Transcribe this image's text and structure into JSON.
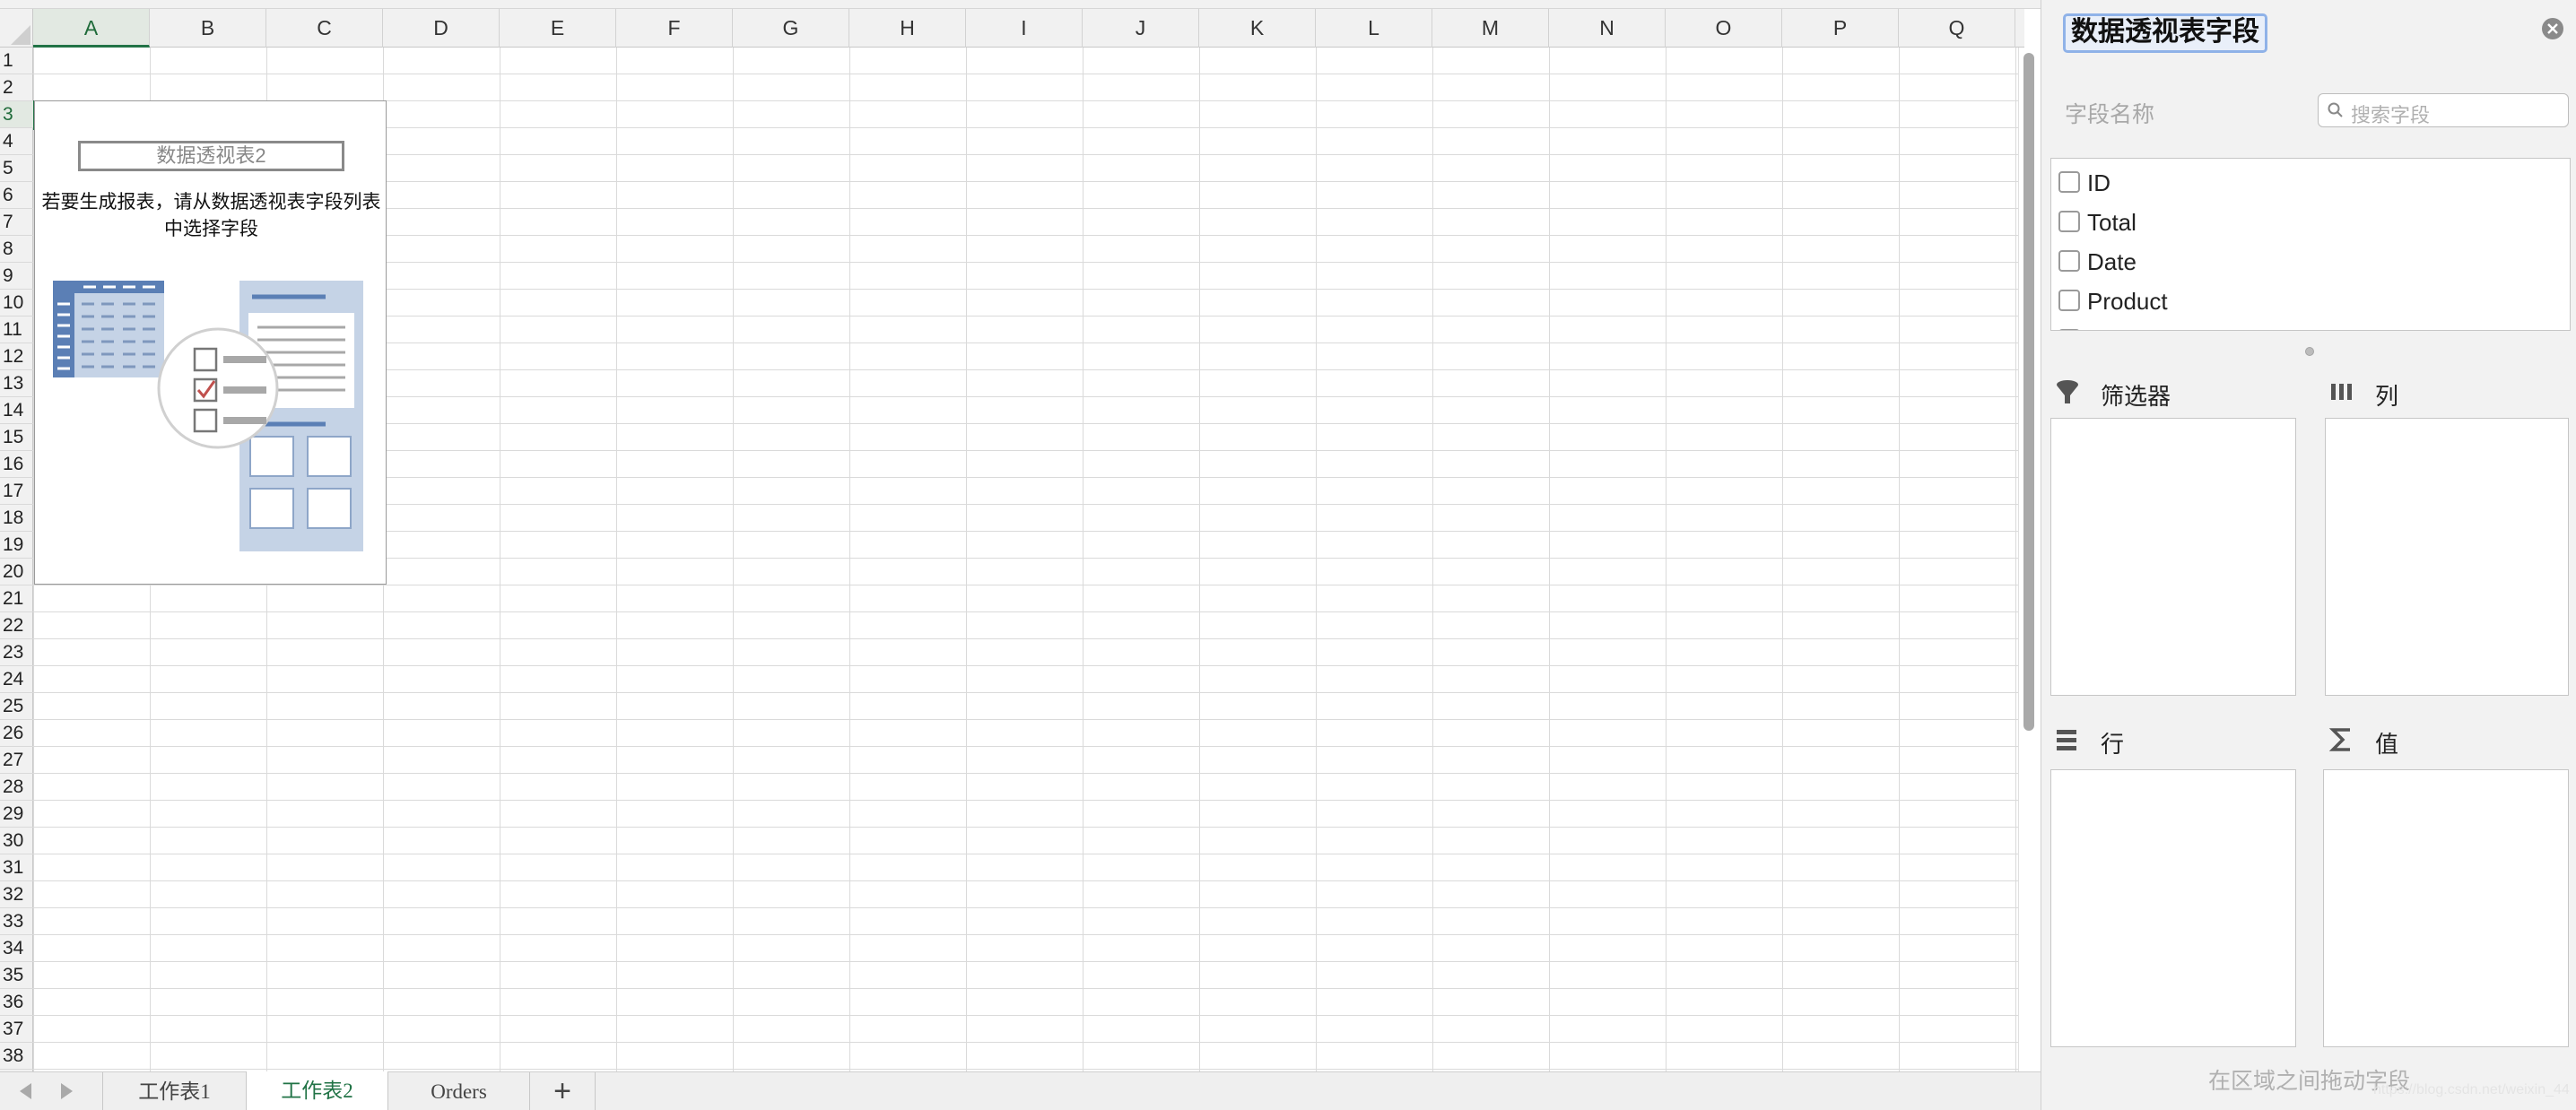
{
  "columns": [
    "A",
    "B",
    "C",
    "D",
    "E",
    "F",
    "G",
    "H",
    "I",
    "J",
    "K",
    "L",
    "M",
    "N",
    "O",
    "P",
    "Q"
  ],
  "active_column": "A",
  "rows": [
    "1",
    "2",
    "3",
    "4",
    "5",
    "6",
    "7",
    "8",
    "9",
    "10",
    "11",
    "12",
    "13",
    "14",
    "15",
    "16",
    "17",
    "18",
    "19",
    "20",
    "21",
    "22",
    "23",
    "24",
    "25",
    "26",
    "27",
    "28",
    "29",
    "30",
    "31",
    "32",
    "33",
    "34",
    "35",
    "36",
    "37",
    "38"
  ],
  "active_row": "3",
  "pivot_placeholder": {
    "name": "数据透视表2",
    "hint": "若要生成报表，请从数据透视表字段列表中选择字段"
  },
  "sheet_tabs": [
    {
      "label": "工作表1",
      "active": false
    },
    {
      "label": "工作表2",
      "active": true
    },
    {
      "label": "Orders",
      "active": false
    }
  ],
  "add_sheet_label": "+",
  "panel": {
    "title": "数据透视表字段",
    "field_name_label": "字段名称",
    "search_placeholder": "搜索字段",
    "fields": [
      "ID",
      "Total",
      "Date",
      "Product"
    ],
    "areas": {
      "filters": "筛选器",
      "columns": "列",
      "rows": "行",
      "values": "值"
    },
    "footer": "在区域之间拖动字段",
    "watermark": "https://blog.csdn.net/weixin_44"
  },
  "colors": {
    "accent": "#217346",
    "illustration_blue": "#5b7fb5",
    "illustration_light": "#c5d3e6",
    "check_red": "#c0504d"
  }
}
